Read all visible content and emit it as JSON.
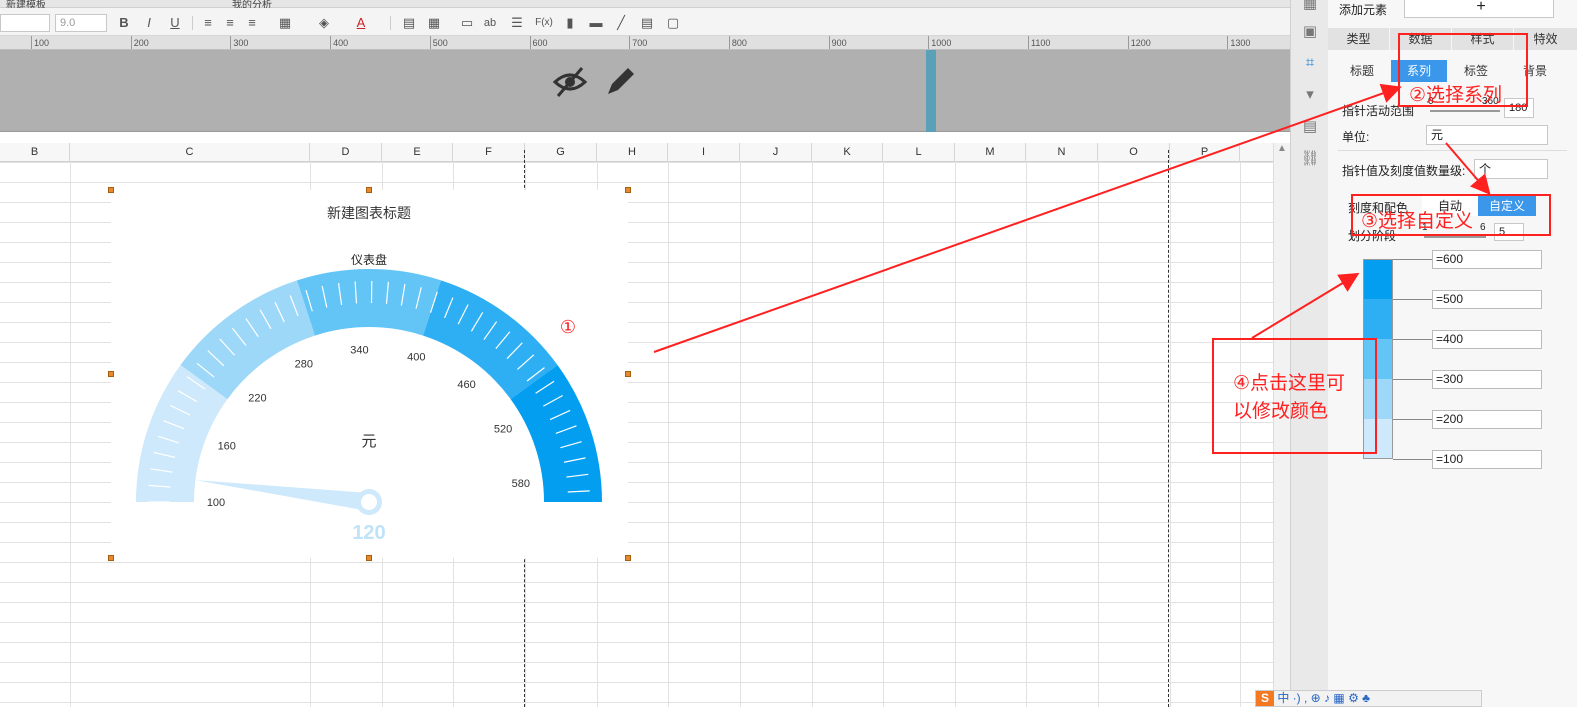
{
  "tabs": {
    "tab1": "新建模板",
    "tab2": "我的分析"
  },
  "toolbar": {
    "font_size": "9.0",
    "bold": "B",
    "italic": "I",
    "underline": "U",
    "text_a": "A",
    "ab": "ab",
    "fx": "F(x)",
    "icons": [
      "align-left-icon",
      "align-center-icon",
      "align-right-icon",
      "border-icon",
      "fill-color-icon",
      "font-color-icon",
      "merge-icon",
      "chart-icon"
    ]
  },
  "ruler": [
    "100",
    "200",
    "300",
    "400",
    "500",
    "600",
    "700",
    "800",
    "900",
    "1000",
    "1100",
    "1200",
    "1300"
  ],
  "columns": [
    "B",
    "C",
    "D",
    "E",
    "F",
    "G",
    "H",
    "I",
    "J",
    "K",
    "L",
    "M",
    "N",
    "O",
    "P"
  ],
  "chart": {
    "title": "新建图表标题",
    "gauge_label": "仪表盘",
    "unit": "元",
    "value_text": "120",
    "annotation": "①"
  },
  "chart_data": {
    "type": "gauge",
    "title": "新建图表标题",
    "series_name": "仪表盘",
    "unit": "元",
    "value": 120,
    "range": [
      100,
      600
    ],
    "ticks": [
      100,
      160,
      220,
      280,
      340,
      400,
      460,
      520,
      580
    ],
    "bands": [
      {
        "from": 100,
        "to": 200,
        "color": "#cde9fb"
      },
      {
        "from": 200,
        "to": 300,
        "color": "#9ed8f8"
      },
      {
        "from": 300,
        "to": 400,
        "color": "#63c4f6"
      },
      {
        "from": 400,
        "to": 500,
        "color": "#2eaff4"
      },
      {
        "from": 500,
        "to": 600,
        "color": "#049ef0"
      }
    ]
  },
  "panel": {
    "add_element": "添加元素",
    "add_symbol": "+",
    "tabs": [
      "类型",
      "数据",
      "样式",
      "特效"
    ],
    "subtabs": [
      "标题",
      "系列",
      "标签",
      "背景"
    ],
    "pointer_range_label": "指针活动范围",
    "pointer_range_min": "0",
    "pointer_range_max": "360",
    "pointer_range_value": "180",
    "unit_label": "单位:",
    "unit_value": "元",
    "magnitude_label": "指针值及刻度值数量级:",
    "magnitude_value": "个",
    "scale_label": "刻度和配色",
    "auto_label": "自动",
    "custom_label": "自定义",
    "stage_label": "划分阶段",
    "stage_slider_min": "1",
    "stage_slider_max": "6",
    "stage_value": "5",
    "segments": [
      "=600",
      "=500",
      "=400",
      "=300",
      "=200",
      "=100"
    ],
    "segment_colors": [
      "#049ef0",
      "#2eaff4",
      "#63c4f6",
      "#9ed8f8",
      "#cde9fb"
    ]
  },
  "annotations": {
    "a2": "②选择系列",
    "a3": "③选择自定义",
    "a4_line1": "④点击这里可",
    "a4_line2": "以修改颜色"
  },
  "taskbar": "中 ·) ,  ⊕ ♪ ▦ ⚙ ♣"
}
